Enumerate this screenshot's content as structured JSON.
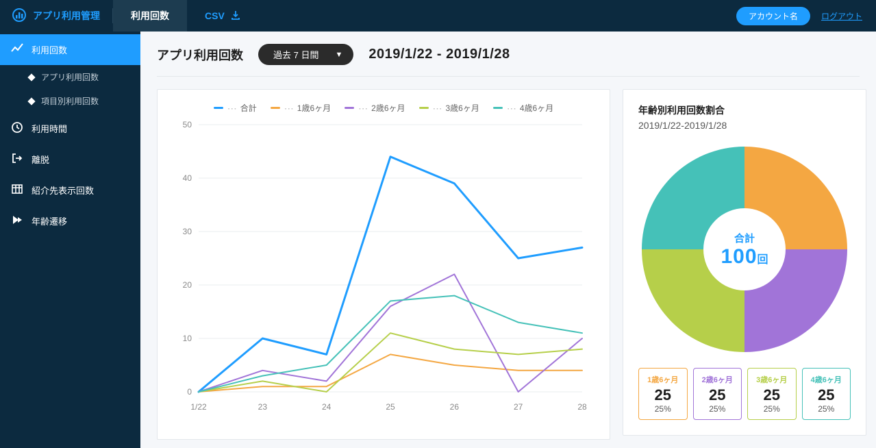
{
  "header": {
    "brand": "アプリ利用管理",
    "tabs": [
      {
        "label": "利用回数",
        "id": "usage"
      },
      {
        "label": "CSV",
        "id": "csv"
      }
    ],
    "account_label": "アカウント名",
    "logout": "ログアウト"
  },
  "sidebar": {
    "items": [
      {
        "label": "利用回数",
        "icon": "trend",
        "active": true,
        "subs": [
          "アプリ利用回数",
          "項目別利用回数"
        ]
      },
      {
        "label": "利用時間",
        "icon": "clock"
      },
      {
        "label": "離脱",
        "icon": "exit"
      },
      {
        "label": "紹介先表示回数",
        "icon": "grid"
      },
      {
        "label": "年齢遷移",
        "icon": "play"
      }
    ]
  },
  "page": {
    "title": "アプリ利用回数",
    "period_label": "過去 7 日間",
    "date_range": "2019/1/22 - 2019/1/28"
  },
  "colors": {
    "c_total": "#1f9dff",
    "c_1y6m": "#f4a742",
    "c_2y6m": "#a174d8",
    "c_3y6m": "#b6cf4a",
    "c_4y6m": "#45c1b8"
  },
  "chart_data": {
    "type": "line",
    "title": "",
    "xlabel": "",
    "ylabel": "",
    "ylim": [
      0,
      50
    ],
    "yticks": [
      0,
      10,
      20,
      30,
      40,
      50
    ],
    "categories": [
      "1/22",
      "23",
      "24",
      "25",
      "26",
      "27",
      "28"
    ],
    "series": [
      {
        "name": "合計",
        "color": "#1f9dff",
        "values": [
          0,
          10,
          7,
          44,
          39,
          25,
          27
        ]
      },
      {
        "name": "1歳6ヶ月",
        "color": "#f4a742",
        "values": [
          0,
          1,
          1,
          7,
          5,
          4,
          4
        ]
      },
      {
        "name": "2歳6ヶ月",
        "color": "#a174d8",
        "values": [
          0,
          4,
          2,
          16,
          22,
          0,
          10
        ]
      },
      {
        "name": "3歳6ヶ月",
        "color": "#b6cf4a",
        "values": [
          0,
          2,
          0,
          11,
          8,
          7,
          8
        ]
      },
      {
        "name": "4歳6ヶ月",
        "color": "#45c1b8",
        "values": [
          0,
          3,
          5,
          17,
          18,
          13,
          11
        ]
      }
    ]
  },
  "donut": {
    "title": "年齢別利用回数割合",
    "subtitle": "2019/1/22-2019/1/28",
    "center_label": "合計",
    "center_value": "100",
    "center_unit": "回",
    "segments": [
      {
        "name": "1歳6ヶ月",
        "value": 25,
        "pct": "25%",
        "color": "#f4a742"
      },
      {
        "name": "2歳6ヶ月",
        "value": 25,
        "pct": "25%",
        "color": "#a174d8"
      },
      {
        "name": "3歳6ヶ月",
        "value": 25,
        "pct": "25%",
        "color": "#b6cf4a"
      },
      {
        "name": "4歳6ヶ月",
        "value": 25,
        "pct": "25%",
        "color": "#45c1b8"
      }
    ]
  }
}
